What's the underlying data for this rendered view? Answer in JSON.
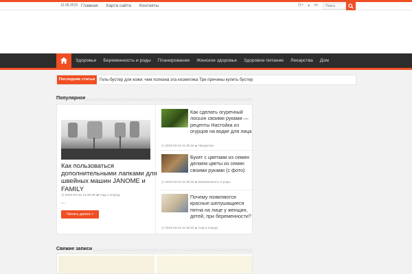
{
  "topbar": {
    "date": "12.06.2023",
    "nav": [
      "Главная",
      "Карта сайта",
      "Контакты"
    ],
    "search_placeholder": "Поиск"
  },
  "colors": {
    "accent": "#f04e23",
    "nav_bg": "#2d2d2d"
  },
  "main_nav": {
    "home_icon": "home-icon",
    "items": [
      "Здоровье",
      "Беременность и роды",
      "Планирование",
      "Женское здоровье",
      "Здоровое питание",
      "Лекарства",
      "Дом"
    ]
  },
  "ticker": {
    "label": "Последние статьи",
    "text": "Гель-бустер для кожи: чем полезна эта косметика Три причины купить бустер"
  },
  "popular": {
    "title": "Популярное",
    "feature": {
      "title": "Как пользоваться дополнительными лапками для швейных машин JANOME и FAMILY",
      "date": "2023-03-16 11:35:39",
      "category": "Сад и огород",
      "excerpt": "...",
      "more": "Читать далее »"
    },
    "side": [
      {
        "title": "Как сделать огуречный лосьон своими руками — рецепты Настойка из огурцов на водке для лица",
        "date": "2023-03-16 11:35:34",
        "category": "Лекарства"
      },
      {
        "title": "Букет с цветами из семян: делаем цветы из семян своими руками (с фото)",
        "date": "2023-03-16 11:35:34",
        "category": "Беременность и роды"
      },
      {
        "title": "Почему появляются красные шелушащиеся пятна на лице у женщин, детей, при беременности?",
        "date": "2023-03-16 11:35:34",
        "category": "Сад и огород"
      }
    ]
  },
  "fresh": {
    "title": "Свежие записи"
  }
}
